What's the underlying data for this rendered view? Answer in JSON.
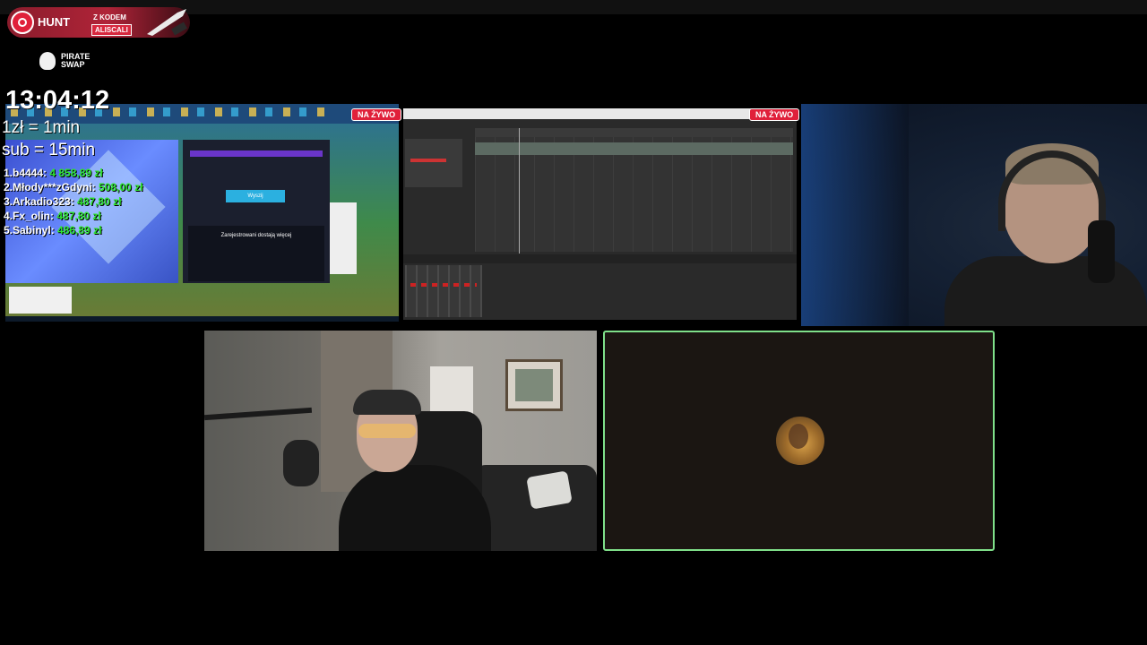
{
  "sponsor": {
    "brand": "HUNT",
    "code_label": "Z KODEM",
    "code": "ALISCALI",
    "partner": "PIRATE SWAP"
  },
  "overlay": {
    "clock": "13:04:12",
    "rate_line_1": "1zł = 1min",
    "rate_line_2": "sub = 15min",
    "leaderboard": [
      {
        "name": "1.b4444:",
        "amount": "4 858,89 zł"
      },
      {
        "name": "2.Młody***zGdyni:",
        "amount": "508,00 zł"
      },
      {
        "name": "3.Arkadio323:",
        "amount": "487,80 zł"
      },
      {
        "name": "4.Fx_olin:",
        "amount": "487,80 zł"
      },
      {
        "name": "5.Sabinyl:",
        "amount": "486,89 zł"
      }
    ]
  },
  "screens": {
    "live_badge_1": "NA ŻYWO",
    "live_badge_2": "NA ŻYWO",
    "share1_button": "Wyszij",
    "share1_heading": "Zarejestrowani dostają więcej"
  },
  "colors": {
    "live_badge": "#e0203a",
    "leader_amount": "#2ee62e",
    "active_speaker_border": "#7fe08a"
  }
}
